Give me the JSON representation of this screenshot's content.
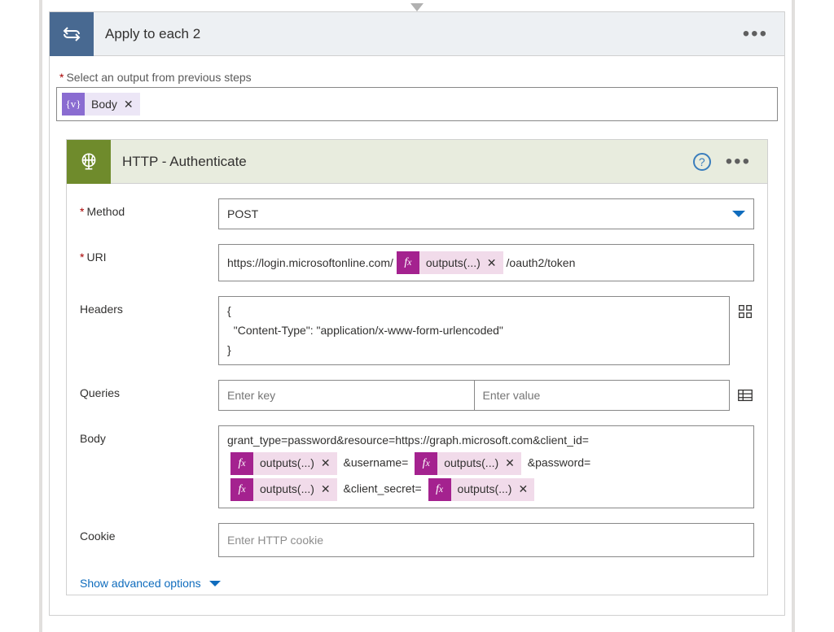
{
  "outer": {
    "title": "Apply to each 2",
    "select_output_label": "Select an output from previous steps",
    "token_label": "Body"
  },
  "inner": {
    "title": "HTTP - Authenticate",
    "method": {
      "label": "Method",
      "value": "POST"
    },
    "uri": {
      "label": "URI",
      "prefix": "https://login.microsoftonline.com/",
      "fx_label": "outputs(...)",
      "suffix": "/oauth2/token"
    },
    "headers": {
      "label": "Headers",
      "text": "{\n  \"Content-Type\": \"application/x-www-form-urlencoded\"\n}"
    },
    "queries": {
      "label": "Queries",
      "key_placeholder": "Enter key",
      "value_placeholder": "Enter value"
    },
    "body": {
      "label": "Body",
      "line1": "grant_type=password&resource=https://graph.microsoft.com&client_id=",
      "fx_label": "outputs(...)",
      "seg_username": "&username=",
      "seg_password": "&password=",
      "seg_client_secret": "&client_secret="
    },
    "cookie": {
      "label": "Cookie",
      "placeholder": "Enter HTTP cookie"
    },
    "advanced": "Show advanced options"
  }
}
